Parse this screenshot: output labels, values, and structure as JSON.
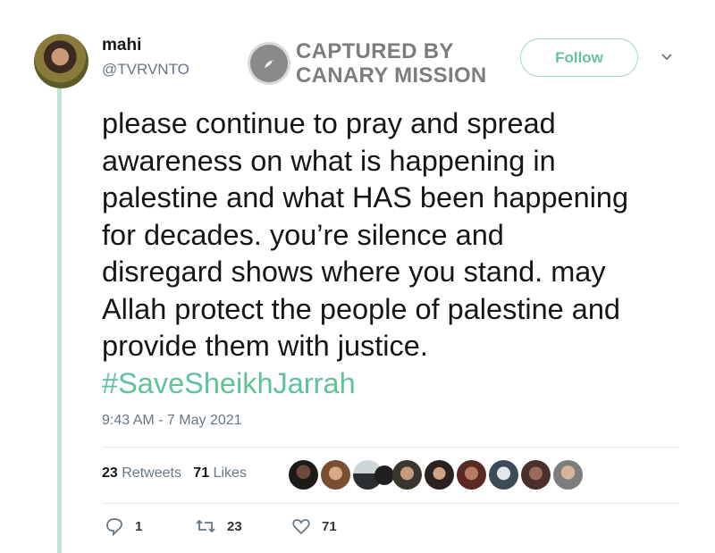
{
  "user": {
    "name": "mahi",
    "handle": "@TVRVNTO"
  },
  "watermark": {
    "line1": "CAPTURED BY",
    "line2": "CANARY MISSION"
  },
  "follow_label": "Follow",
  "tweet": {
    "lines": [
      "please continue to pray and spread",
      "awareness on what is happening in",
      "palestine and what HAS been happening",
      "for decades. you’re silence and",
      "disregard shows where you stand. may",
      "Allah protect the people of palestine and",
      "provide them with justice."
    ],
    "hashtag": "#SaveSheikhJarrah",
    "timestamp": "9:43 AM - 7 May 2021"
  },
  "stats": {
    "retweets_count": "23",
    "retweets_label": "Retweets",
    "likes_count": "71",
    "likes_label": "Likes"
  },
  "actions": {
    "replies": "1",
    "retweets": "23",
    "likes": "71"
  },
  "colors": {
    "accent": "#5fc29a",
    "rail": "#bfe6d4",
    "muted": "#657786"
  },
  "icons": [
    "reply-icon",
    "retweet-icon",
    "heart-icon",
    "chevron-down-icon",
    "canary-bird-icon"
  ]
}
